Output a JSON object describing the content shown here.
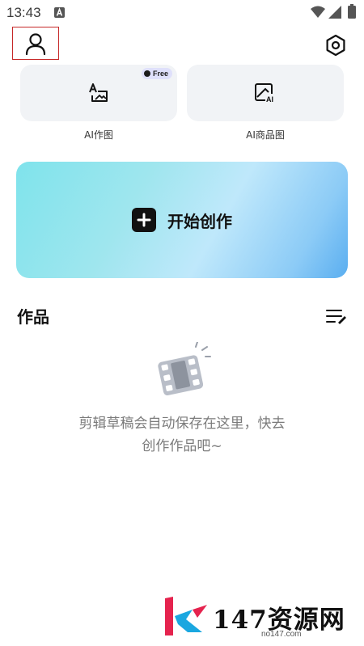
{
  "status_bar": {
    "time": "13:43"
  },
  "header": {
    "profile_icon": "person-icon",
    "settings_icon": "settings-hexagon-icon"
  },
  "ai_tools": [
    {
      "label": "AI作图",
      "icon": "text-image-icon",
      "badge": "Free"
    },
    {
      "label": "AI商品图",
      "icon": "ai-image-icon"
    }
  ],
  "start_creation": {
    "label": "开始创作",
    "icon": "plus-icon"
  },
  "works": {
    "title": "作品",
    "sort_icon": "list-edit-icon",
    "empty_line1": "剪辑草稿会自动保存在这里，快去",
    "empty_line2": "创作作品吧~"
  },
  "watermark": {
    "text": "147资源网",
    "sub": "no147.com"
  },
  "colors": {
    "card_bg": "#f1f3f6",
    "banner_start": "#7fe3ec",
    "banner_end": "#5aaef0",
    "highlight_border": "#c62828"
  }
}
